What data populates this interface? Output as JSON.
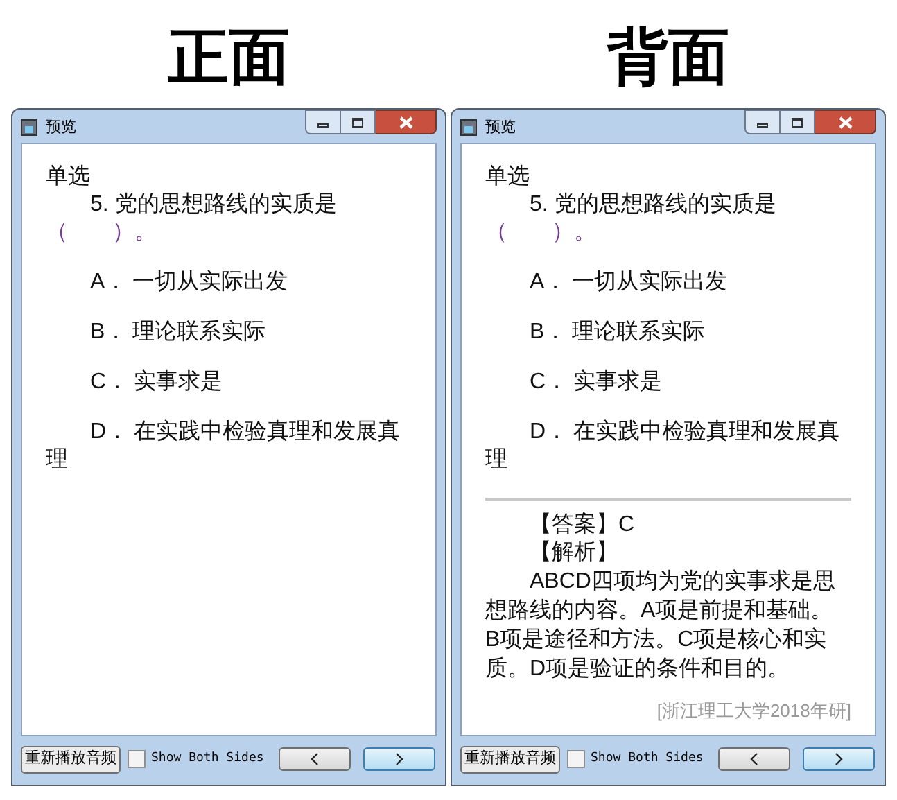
{
  "panels": [
    {
      "heading": "正面",
      "window": {
        "title": "预览"
      },
      "question_type": "单选",
      "question": "5. 党的思想路线的实质是",
      "blank": "（　　）。",
      "options": [
        {
          "label": "A．",
          "text": "一切从实际出发"
        },
        {
          "label": "B．",
          "text": "理论联系实际"
        },
        {
          "label": "C．",
          "text": "实事求是"
        },
        {
          "label": "D．",
          "text": "在实践中检验真理和发展真理"
        }
      ],
      "footer": {
        "replay_button": "重新播放音频",
        "show_both_sides": {
          "label": "Show Both Sides",
          "checked": false
        }
      }
    },
    {
      "heading": "背面",
      "window": {
        "title": "预览"
      },
      "question_type": "单选",
      "question": "5. 党的思想路线的实质是",
      "blank": "（　　）。",
      "options": [
        {
          "label": "A．",
          "text": "一切从实际出发"
        },
        {
          "label": "B．",
          "text": "理论联系实际"
        },
        {
          "label": "C．",
          "text": "实事求是"
        },
        {
          "label": "D．",
          "text": "在实践中检验真理和发展真理"
        }
      ],
      "answer": {
        "answer_line": "【答案】C",
        "analysis_heading": "【解析】",
        "analysis": "ABCD四项均为党的实事求是思想路线的内容。A项是前提和基础。B项是途径和方法。C项是核心和实质。D项是验证的条件和目的。",
        "source": "[浙江理工大学2018年研]"
      },
      "footer": {
        "replay_button": "重新播放音频",
        "show_both_sides": {
          "label": "Show Both Sides",
          "checked": false
        }
      }
    }
  ]
}
